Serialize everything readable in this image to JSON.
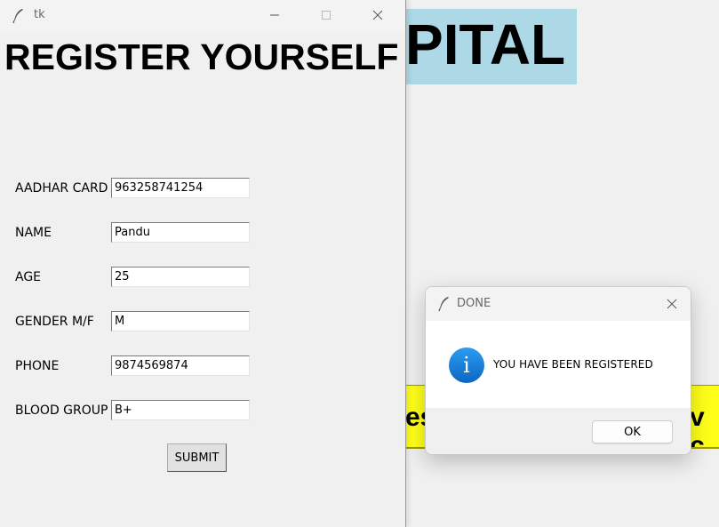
{
  "background_window": {
    "title_fragment": "PITAL",
    "banner_left_fragment": "es",
    "banner_right_fragment": "v c"
  },
  "register_window": {
    "title": "tk",
    "heading": "REGISTER YOURSELF",
    "fields": [
      {
        "label": "AADHAR CARD NO",
        "value": "963258741254"
      },
      {
        "label": "NAME",
        "value": "Pandu"
      },
      {
        "label": "AGE",
        "value": "25"
      },
      {
        "label": "GENDER M/F",
        "value": "M"
      },
      {
        "label": "PHONE",
        "value": "9874569874"
      },
      {
        "label": "BLOOD GROUP",
        "value": "B+"
      }
    ],
    "submit_label": "SUBMIT"
  },
  "dialog": {
    "title": "DONE",
    "message": "YOU HAVE BEEN REGISTERED",
    "ok_label": "OK",
    "icon": "info-icon"
  },
  "colors": {
    "title_box": "#add8e6",
    "banner": "#ffff1a",
    "info_icon": "#0b66c2"
  }
}
